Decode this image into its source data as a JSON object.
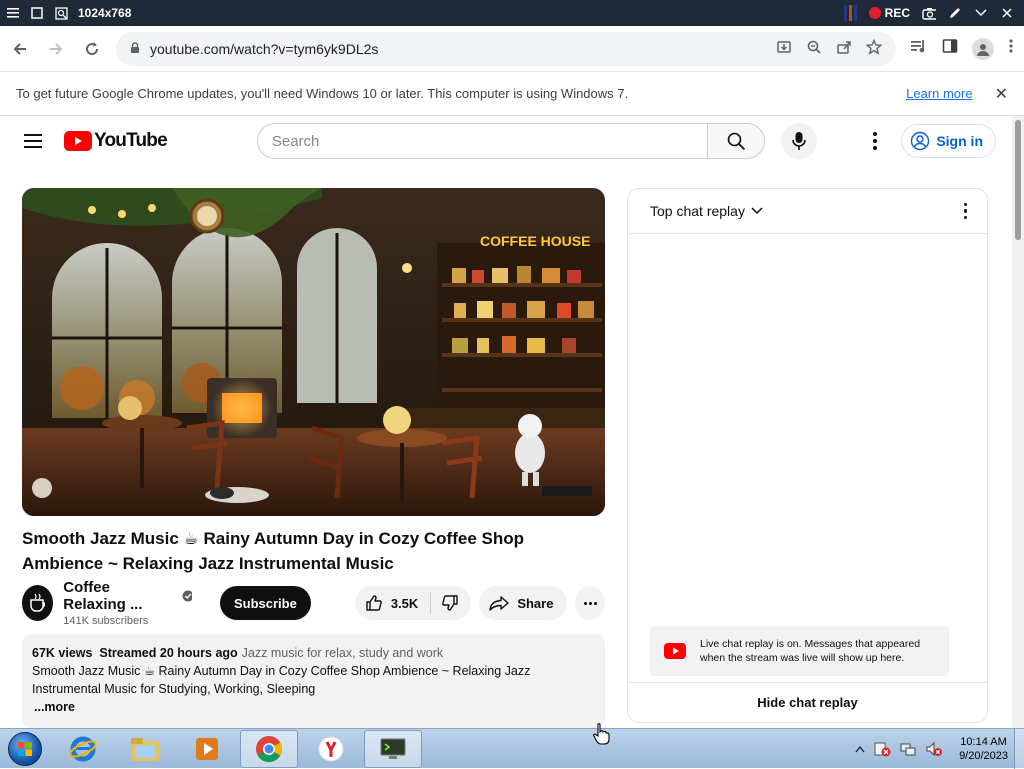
{
  "viewer": {
    "resolution": "1024x768",
    "rec_label": "REC"
  },
  "browser": {
    "url": "youtube.com/watch?v=tym6yk9DL2s"
  },
  "infobar": {
    "message": "To get future Google Chrome updates, you'll need Windows 10 or later. This computer is using Windows 7.",
    "learn_more": "Learn more",
    "close": "✕"
  },
  "youtube": {
    "logo_text": "YouTube",
    "search_placeholder": "Search",
    "sign_in": "Sign in"
  },
  "video": {
    "title": "Smooth Jazz Music ☕ Rainy Autumn Day in Cozy Coffee Shop Ambience ~ Relaxing Jazz Instrumental Music",
    "sign_text": "COFFEE HOUSE",
    "channel_name": "Coffee Relaxing ...",
    "subscribers": "141K subscribers",
    "subscribe": "Subscribe",
    "likes": "3.5K",
    "share": "Share"
  },
  "description": {
    "views": "67K views",
    "streamed": "Streamed 20 hours ago",
    "tags": "Jazz music for relax, study and work",
    "text": "Smooth Jazz Music ☕ Rainy Autumn Day in Cozy Coffee Shop Ambience ~ Relaxing Jazz Instrumental Music for Studying, Working, Sleeping",
    "more": "...more"
  },
  "chat": {
    "header": "Top chat replay",
    "notice": "Live chat replay is on. Messages that appeared when the stream was live will show up here.",
    "hide": "Hide chat replay"
  },
  "taskbar": {
    "time": "10:14 AM",
    "date": "9/20/2023"
  },
  "colors": {
    "youtube_red": "#ff0000",
    "link_blue": "#065fd4",
    "chrome_link": "#1a73e8"
  }
}
